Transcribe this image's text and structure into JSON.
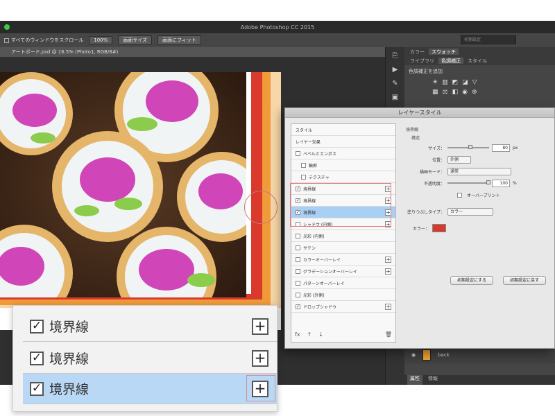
{
  "window": {
    "title": "Adobe Photoshop CC 2015"
  },
  "options_bar": {
    "scroll_all_label": "すべてのウィンドウをスクロール",
    "zoom_100": "100%",
    "fit_screen": "画面サイズ",
    "fill_screen": "画面にフィット",
    "workspace": "初期設定"
  },
  "document": {
    "tab_label": "アートボード.psd @ 16.5% (Photo1, RGB/8#)"
  },
  "panels": {
    "top_tabs": [
      "スウォッチ",
      "カラー"
    ],
    "second_tabs": [
      "ライブラリ",
      "色調補正",
      "スタイル"
    ],
    "adjust_title": "色調補正を追加",
    "layer_name": "back",
    "bottom_tabs": [
      "属性",
      "情報"
    ]
  },
  "dialog": {
    "title": "レイヤースタイル",
    "styles": [
      {
        "label": "スタイル",
        "checkbox": false,
        "checked": false,
        "plus": false,
        "selected": false,
        "indent": false
      },
      {
        "label": "レイヤー効果",
        "checkbox": false,
        "checked": false,
        "plus": false,
        "selected": false,
        "indent": false
      },
      {
        "label": "ベベルとエンボス",
        "checkbox": true,
        "checked": false,
        "plus": false,
        "selected": false,
        "indent": false
      },
      {
        "label": "輪郭",
        "checkbox": true,
        "checked": false,
        "plus": false,
        "selected": false,
        "indent": true
      },
      {
        "label": "テクスチャ",
        "checkbox": true,
        "checked": false,
        "plus": false,
        "selected": false,
        "indent": true
      },
      {
        "label": "境界線",
        "checkbox": true,
        "checked": true,
        "plus": true,
        "selected": false,
        "indent": false
      },
      {
        "label": "境界線",
        "checkbox": true,
        "checked": true,
        "plus": true,
        "selected": false,
        "indent": false
      },
      {
        "label": "境界線",
        "checkbox": true,
        "checked": true,
        "plus": true,
        "selected": true,
        "indent": false
      },
      {
        "label": "シャドウ (内側)",
        "checkbox": true,
        "checked": false,
        "plus": true,
        "selected": false,
        "indent": false
      },
      {
        "label": "光彩 (内側)",
        "checkbox": true,
        "checked": false,
        "plus": false,
        "selected": false,
        "indent": false
      },
      {
        "label": "サテン",
        "checkbox": true,
        "checked": false,
        "plus": false,
        "selected": false,
        "indent": false
      },
      {
        "label": "カラーオーバーレイ",
        "checkbox": true,
        "checked": false,
        "plus": true,
        "selected": false,
        "indent": false
      },
      {
        "label": "グラデーションオーバーレイ",
        "checkbox": true,
        "checked": false,
        "plus": true,
        "selected": false,
        "indent": false
      },
      {
        "label": "パターンオーバーレイ",
        "checkbox": true,
        "checked": false,
        "plus": false,
        "selected": false,
        "indent": false
      },
      {
        "label": "光彩 (外側)",
        "checkbox": true,
        "checked": false,
        "plus": false,
        "selected": false,
        "indent": false
      },
      {
        "label": "ドロップシャドウ",
        "checkbox": true,
        "checked": true,
        "plus": true,
        "selected": false,
        "indent": false
      }
    ],
    "list_footer_icons": [
      "fx",
      "↑",
      "↓",
      "🗑"
    ],
    "section_title": "境界線",
    "structure_label": "構造",
    "size_label": "サイズ：",
    "size_value": "80",
    "size_unit": "px",
    "position_label": "位置：",
    "position_value": "外側",
    "blend_mode_label": "描画モード：",
    "blend_mode_value": "通常",
    "opacity_label": "不透明度：",
    "opacity_value": "100",
    "opacity_unit": "%",
    "overprint_label": "オーバープリント",
    "fill_type_label": "塗りつぶしタイプ：",
    "fill_type_value": "カラー",
    "color_label": "カラー：",
    "stroke_color": "#d63a2e",
    "btn_make_default": "初期設定にする",
    "btn_reset_default": "初期設定に戻す"
  },
  "callout": {
    "rows": [
      {
        "label": "境界線",
        "checked": true,
        "selected": false
      },
      {
        "label": "境界線",
        "checked": true,
        "selected": false
      },
      {
        "label": "境界線",
        "checked": true,
        "selected": true
      }
    ],
    "plus_symbol": "+"
  },
  "colors": {
    "artboard_stripe_red": "#d93a2c",
    "artboard_stripe_orange": "#f09a3a",
    "artboard_stripe_peach": "#f7d7a8",
    "selected_row": "#a9cff4"
  }
}
